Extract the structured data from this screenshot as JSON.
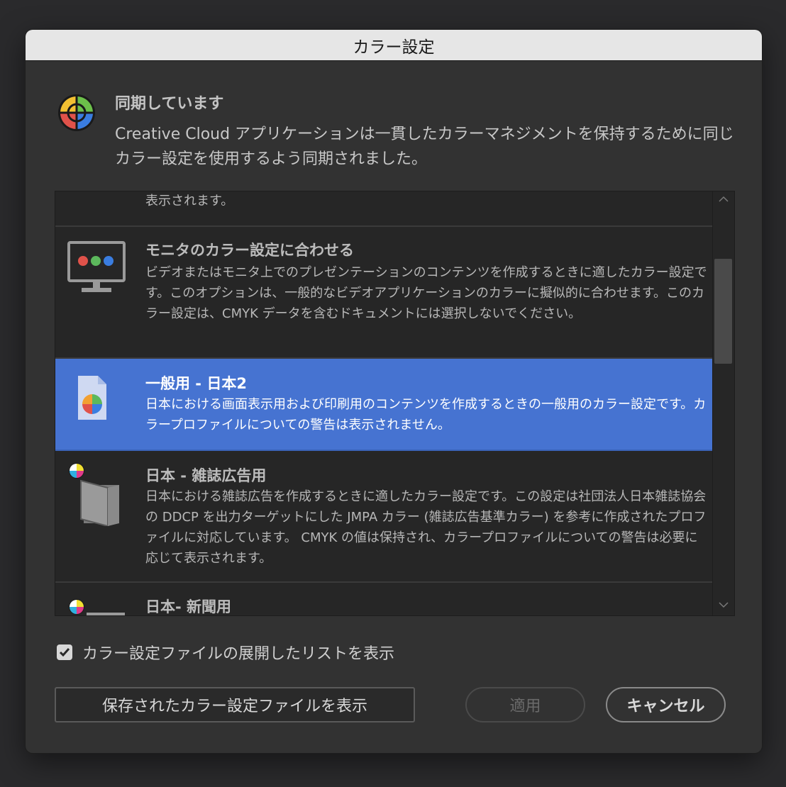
{
  "dialog": {
    "title": "カラー設定",
    "sync_heading": "同期しています",
    "sync_description": "Creative Cloud アプリケーションは一貫したカラーマネジメントを保持するために同じカラー設定を使用するよう同期されました。"
  },
  "list": {
    "items": [
      {
        "title": "",
        "description": "表示されます。"
      },
      {
        "title": "モニタのカラー設定に合わせる",
        "description": "ビデオまたはモニタ上でのプレゼンテーションのコンテンツを作成するときに適したカラー設定です。このオプションは、一般的なビデオアプリケーションのカラーに擬似的に合わせます。このカラー設定は、CMYK データを含むドキュメントには選択しないでください。"
      },
      {
        "title": "一般用 - 日本2",
        "description": "日本における画面表示用および印刷用のコンテンツを作成するときの一般用のカラー設定です。カラープロファイルについての警告は表示されません。",
        "selected": true
      },
      {
        "title": "日本 - 雑誌広告用",
        "description": "日本における雑誌広告を作成するときに適したカラー設定です。この設定は社団法人日本雑誌協会の DDCP を出力ターゲットにした JMPA カラー (雑誌広告基準カラー) を参考に作成されたプロファイルに対応しています。 CMYK の値は保持され、カラープロファイルについての警告は必要に応じて表示されます。"
      },
      {
        "title": "日本- 新聞用",
        "description": ""
      }
    ]
  },
  "options": {
    "expanded_list_label": "カラー設定ファイルの展開したリストを表示",
    "expanded_list_checked": true
  },
  "buttons": {
    "show_saved": "保存されたカラー設定ファイルを表示",
    "apply": "適用",
    "cancel": "キャンセル"
  },
  "colors": {
    "selection": "#4673d1",
    "background": "#323232"
  }
}
